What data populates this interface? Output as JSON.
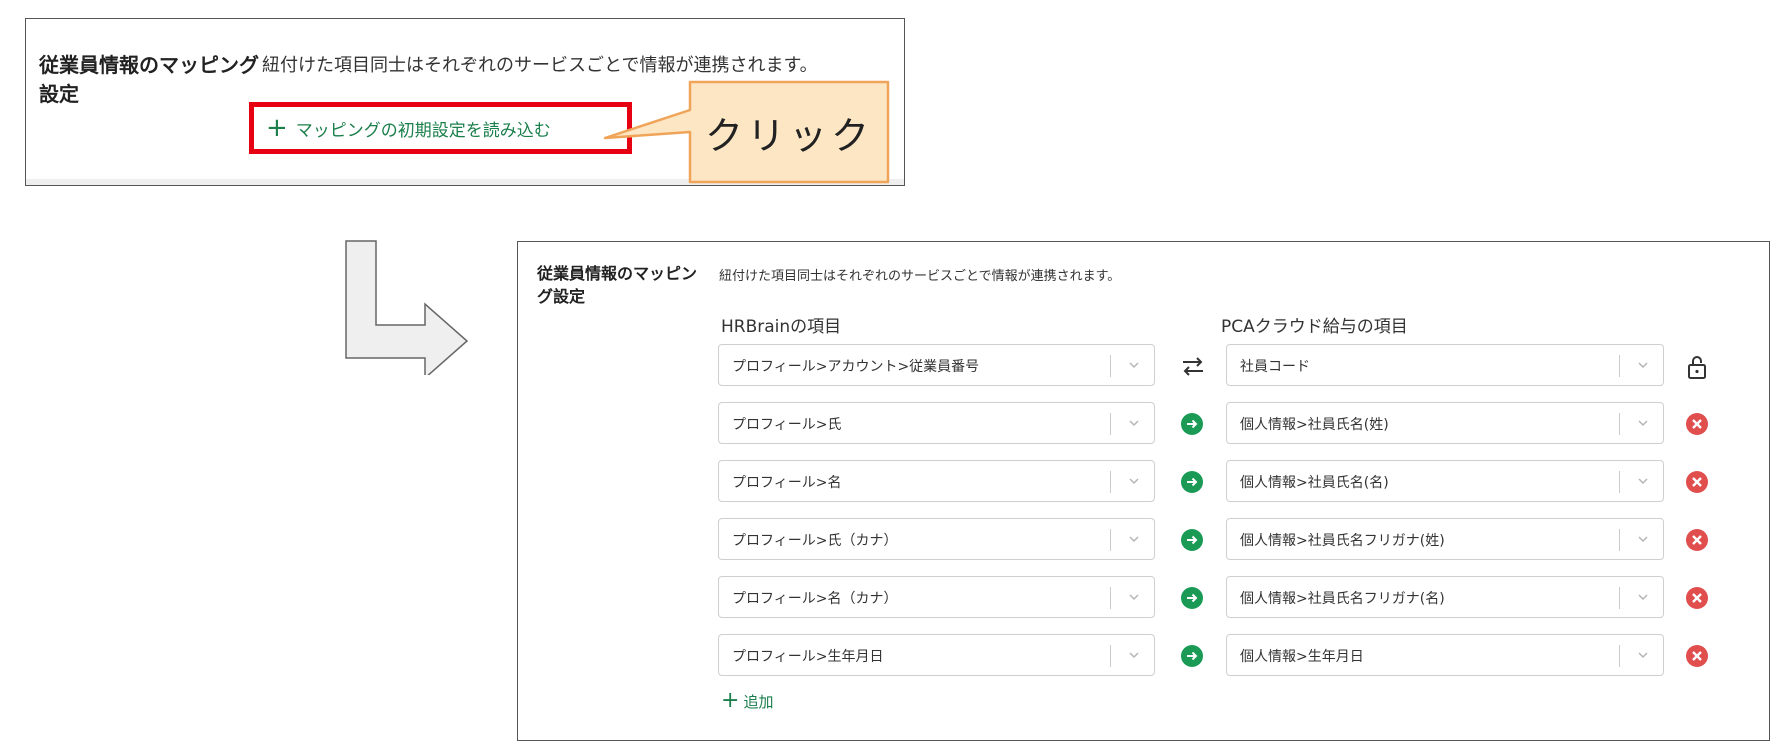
{
  "top_panel": {
    "section_label": "従業員情報のマッピング設定",
    "description": "紐付けた項目同士はそれぞれのサービスごとで情報が連携されます。",
    "load_button_label": "マッピングの初期設定を読み込む"
  },
  "callout": {
    "text": "クリック",
    "fill_color": "#fde6c4",
    "border_color": "#f0a45a"
  },
  "bottom_panel": {
    "section_label": "従業員情報のマッピング設定",
    "description": "紐付けた項目同士はそれぞれのサービスごとで情報が連携されます。",
    "left_column_header": "HRBrainの項目",
    "right_column_header": "PCAクラウド給与の項目",
    "rows": [
      {
        "left": "プロフィール>アカウント>従業員番号",
        "right": "社員コード",
        "mid_icon": "swap-arrows-icon",
        "end_icon": "lock-icon"
      },
      {
        "left": "プロフィール>氏",
        "right": "個人情報>社員氏名(姓)",
        "mid_icon": "arrow-right-circle-icon",
        "end_icon": "remove-icon"
      },
      {
        "left": "プロフィール>名",
        "right": "個人情報>社員氏名(名)",
        "mid_icon": "arrow-right-circle-icon",
        "end_icon": "remove-icon"
      },
      {
        "left": "プロフィール>氏（カナ）",
        "right": "個人情報>社員氏名フリガナ(姓)",
        "mid_icon": "arrow-right-circle-icon",
        "end_icon": "remove-icon"
      },
      {
        "left": "プロフィール>名（カナ）",
        "right": "個人情報>社員氏名フリガナ(名)",
        "mid_icon": "arrow-right-circle-icon",
        "end_icon": "remove-icon"
      },
      {
        "left": "プロフィール>生年月日",
        "right": "個人情報>生年月日",
        "mid_icon": "arrow-right-circle-icon",
        "end_icon": "remove-icon"
      }
    ],
    "add_label": "追加"
  },
  "colors": {
    "accent_green": "#1a7f4b",
    "highlight_red": "#e60012",
    "remove_red": "#e04e4e"
  }
}
